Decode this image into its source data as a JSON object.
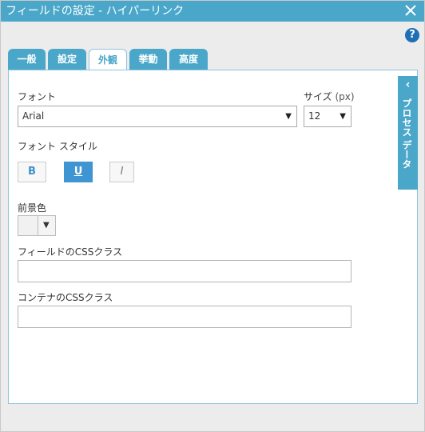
{
  "window": {
    "title": "フィールドの設定 - ハイパーリンク"
  },
  "tabs": [
    {
      "label": "一般",
      "active": false
    },
    {
      "label": "設定",
      "active": false
    },
    {
      "label": "外観",
      "active": true
    },
    {
      "label": "挙動",
      "active": false
    },
    {
      "label": "高度",
      "active": false
    }
  ],
  "help": {
    "label": "?"
  },
  "font": {
    "label": "フォント",
    "value": "Arial"
  },
  "size": {
    "label": "サイズ",
    "unit": "(px)",
    "value": "12"
  },
  "font_style": {
    "label": "フォント スタイル",
    "bold": {
      "label": "B",
      "active": false
    },
    "underline": {
      "label": "U",
      "active": true
    },
    "italic": {
      "label": "I",
      "active": false
    }
  },
  "foreground": {
    "label": "前景色",
    "color": "#f1f1f1"
  },
  "field_css": {
    "label": "フィールドのCSSクラス",
    "value": ""
  },
  "container_css": {
    "label": "コンテナのCSSクラス",
    "value": ""
  },
  "side_panel": {
    "label": "プロセス データ"
  },
  "colors": {
    "accent": "#4aa7c9",
    "active_button": "#3f95d2",
    "help_icon": "#1f6fb4"
  }
}
